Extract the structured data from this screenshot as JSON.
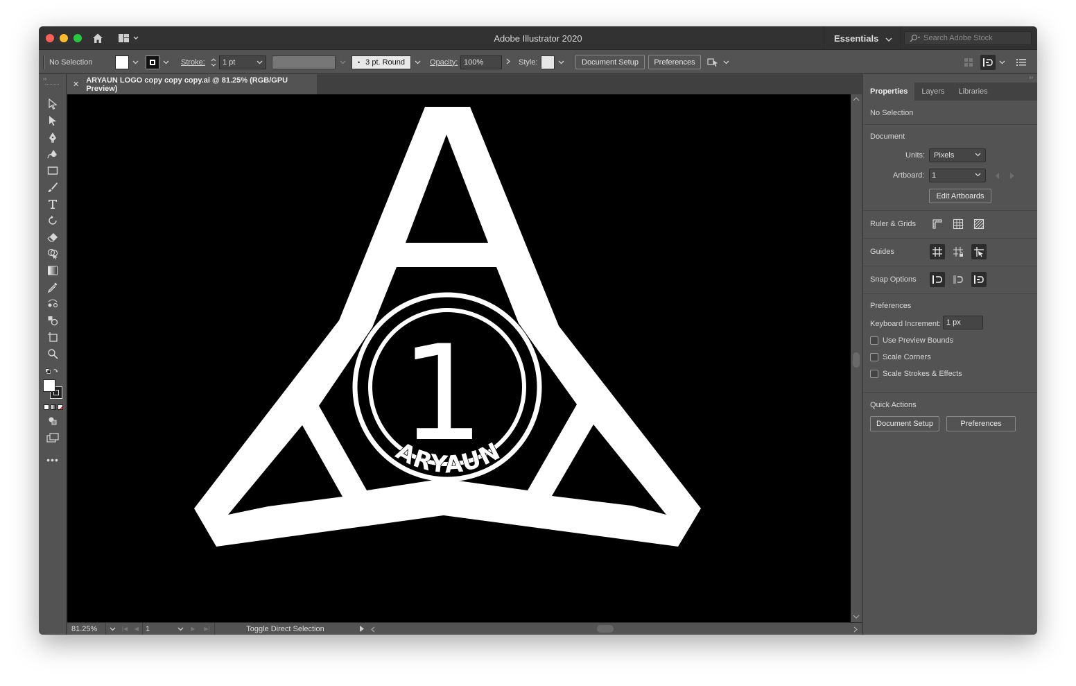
{
  "app": {
    "title": "Adobe Illustrator 2020",
    "workspace": "Essentials",
    "stock_search_placeholder": "Search Adobe Stock"
  },
  "control_bar": {
    "selection": "No Selection",
    "stroke_label": "Stroke:",
    "stroke_weight": "1 pt",
    "brush": "3 pt. Round",
    "opacity_label": "Opacity:",
    "opacity_value": "100%",
    "style_label": "Style:",
    "document_setup": "Document Setup",
    "preferences": "Preferences"
  },
  "document": {
    "tab_title": "ARYAUN LOGO copy copy copy.ai @ 81.25% (RGB/GPU Preview)",
    "artwork": {
      "logo_letter": "A",
      "center_number": "1",
      "arc_text": "ARYAUN",
      "colors": {
        "background": "#000000",
        "foreground": "#ffffff"
      }
    }
  },
  "status_bar": {
    "zoom": "81.25%",
    "artboard": "1",
    "tool_hint": "Toggle Direct Selection"
  },
  "properties_panel": {
    "tabs": [
      {
        "label": "Properties",
        "active": true
      },
      {
        "label": "Layers",
        "active": false
      },
      {
        "label": "Libraries",
        "active": false
      }
    ],
    "selection": "No Selection",
    "document_heading": "Document",
    "units_label": "Units:",
    "units_value": "Pixels",
    "artboard_label": "Artboard:",
    "artboard_value": "1",
    "edit_artboards": "Edit Artboards",
    "ruler_grids": "Ruler & Grids",
    "guides": "Guides",
    "snap_options": "Snap Options",
    "preferences_heading": "Preferences",
    "keyboard_increment_label": "Keyboard Increment:",
    "keyboard_increment_value": "1 px",
    "checkboxes": [
      {
        "label": "Use Preview Bounds",
        "checked": false
      },
      {
        "label": "Scale Corners",
        "checked": false
      },
      {
        "label": "Scale Strokes & Effects",
        "checked": false
      }
    ],
    "quick_actions_heading": "Quick Actions",
    "quick_actions": [
      "Document Setup",
      "Preferences"
    ]
  }
}
